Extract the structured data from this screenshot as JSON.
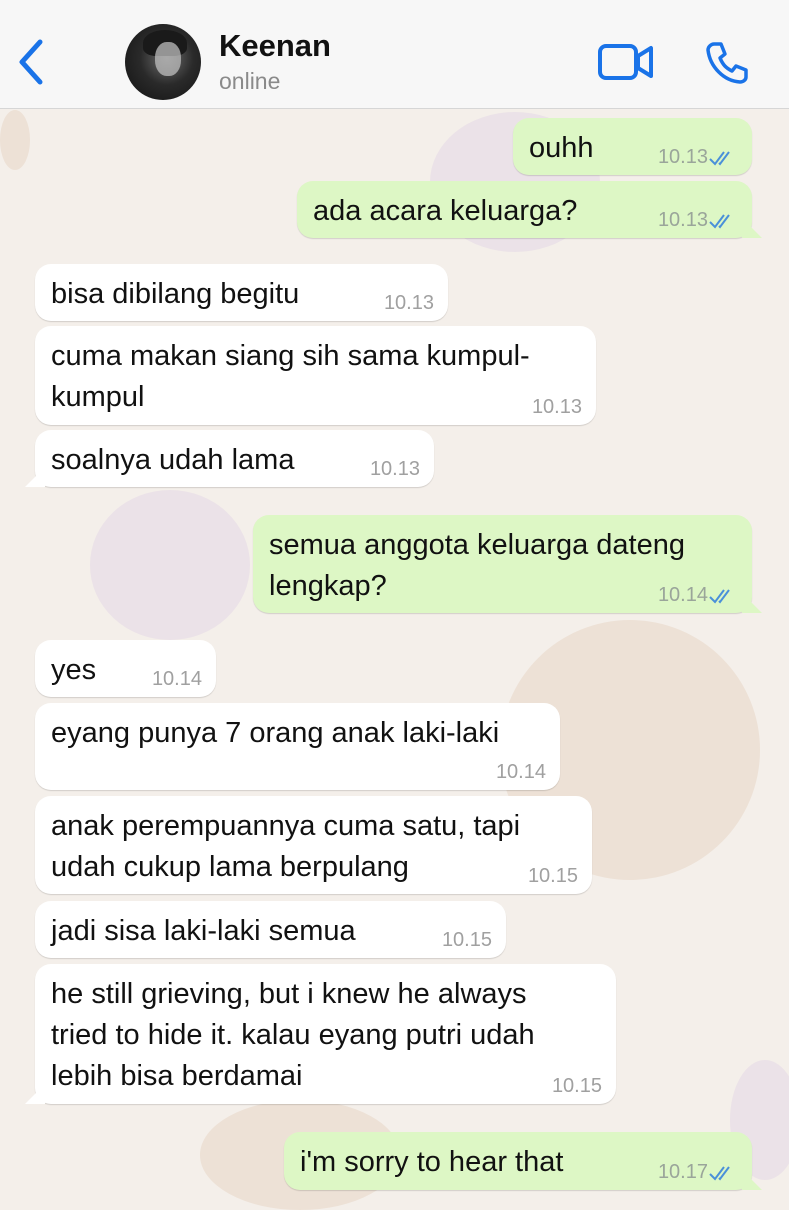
{
  "header": {
    "contact_name": "Keenan",
    "status": "online",
    "back_icon": "chevron-left-icon",
    "video_icon": "video-camera-icon",
    "phone_icon": "phone-icon",
    "accent_color": "#1a73e8"
  },
  "messages": [
    {
      "side": "out",
      "text": "ouhh",
      "time": "10.13",
      "read": true
    },
    {
      "side": "out",
      "text": "ada acara keluarga?",
      "time": "10.13",
      "read": true
    },
    {
      "side": "in",
      "text": "bisa dibilang begitu",
      "time": "10.13"
    },
    {
      "side": "in",
      "text": "cuma makan siang sih sama kumpul-\nkumpul",
      "time": "10.13"
    },
    {
      "side": "in",
      "text": "soalnya udah lama",
      "time": "10.13"
    },
    {
      "side": "out",
      "text": "semua anggota keluarga dateng\nlengkap?",
      "time": "10.14",
      "read": true
    },
    {
      "side": "in",
      "text": "yes",
      "time": "10.14"
    },
    {
      "side": "in",
      "text": "eyang punya 7 orang anak laki-laki",
      "time": "10.14"
    },
    {
      "side": "in",
      "text": "anak perempuannya cuma satu, tapi\nudah cukup lama berpulang",
      "time": "10.15"
    },
    {
      "side": "in",
      "text": "jadi sisa laki-laki semua",
      "time": "10.15"
    },
    {
      "side": "in",
      "text": "he still grieving, but i knew he always\ntried to hide it. kalau eyang putri udah\nlebih bisa berdamai",
      "time": "10.15"
    },
    {
      "side": "out",
      "text": "i'm sorry to hear that",
      "time": "10.17",
      "read": true
    }
  ]
}
